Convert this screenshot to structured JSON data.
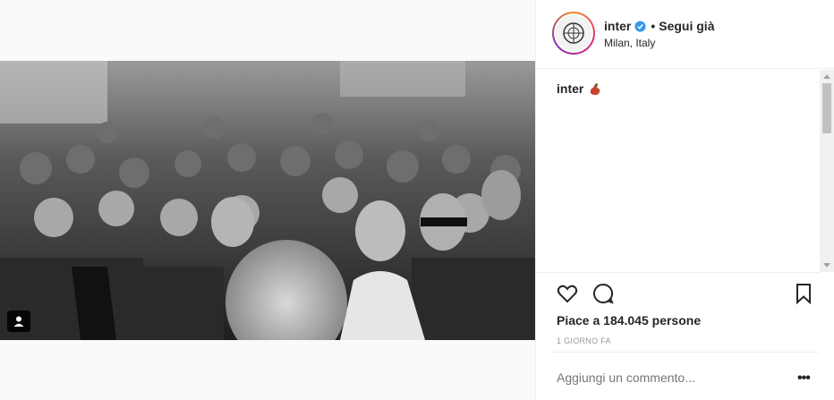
{
  "post": {
    "username": "inter",
    "separator": "•",
    "follow_label": "Segui già",
    "location": "Milan, Italy",
    "caption_user": "inter",
    "likes_text": "Piace a 184.045 persone",
    "timestamp": "1 GIORNO FA",
    "comment_placeholder": "Aggiungi un commento...",
    "more_label": "•••"
  },
  "icons": {
    "verified": "verified-badge-icon",
    "like": "heart-icon",
    "comment": "comment-icon",
    "save": "bookmark-icon",
    "tag": "user-tag-icon",
    "caption_emoji": "flexed-arm-emoji-icon"
  },
  "colors": {
    "verified": "#3897f0",
    "text": "#262626",
    "muted": "#999999"
  }
}
